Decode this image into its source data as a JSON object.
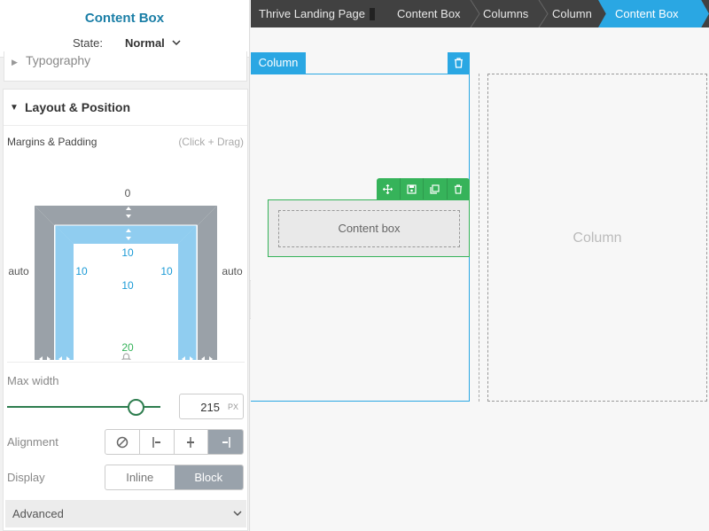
{
  "panel": {
    "title": "Content Box",
    "state_label": "State:",
    "state_value": "Normal",
    "typography_label": "Typography",
    "layout_title": "Layout & Position",
    "margins_label": "Margins & Padding",
    "margins_hint": "(Click + Drag)",
    "margin": {
      "top": "0",
      "left": "auto",
      "right": "auto",
      "bottom": "20"
    },
    "padding": {
      "top": "10",
      "left": "10",
      "right": "10",
      "bottom": "10"
    },
    "max_width_label": "Max width",
    "max_width_value": "215",
    "max_width_unit": "PX",
    "max_width_level": 0.84,
    "alignment_label": "Alignment",
    "display_label": "Display",
    "display_options": [
      "Inline",
      "Block"
    ],
    "display_selected": "Block",
    "advanced_label": "Advanced"
  },
  "breadcrumb": [
    "Thrive Landing Page",
    "Content Box",
    "Columns",
    "Column",
    "Content Box"
  ],
  "canvas": {
    "column_tag": "Column",
    "content_box_text": "Content box",
    "empty_column_label": "Column"
  },
  "colors": {
    "accent_blue": "#2aa7e3",
    "accent_green": "#36b35a",
    "title_blue": "#1a7ea6",
    "padding_blue": "#90cdf0",
    "margin_grey": "#9aa1a8",
    "margin_green": "#a6e4b9"
  }
}
